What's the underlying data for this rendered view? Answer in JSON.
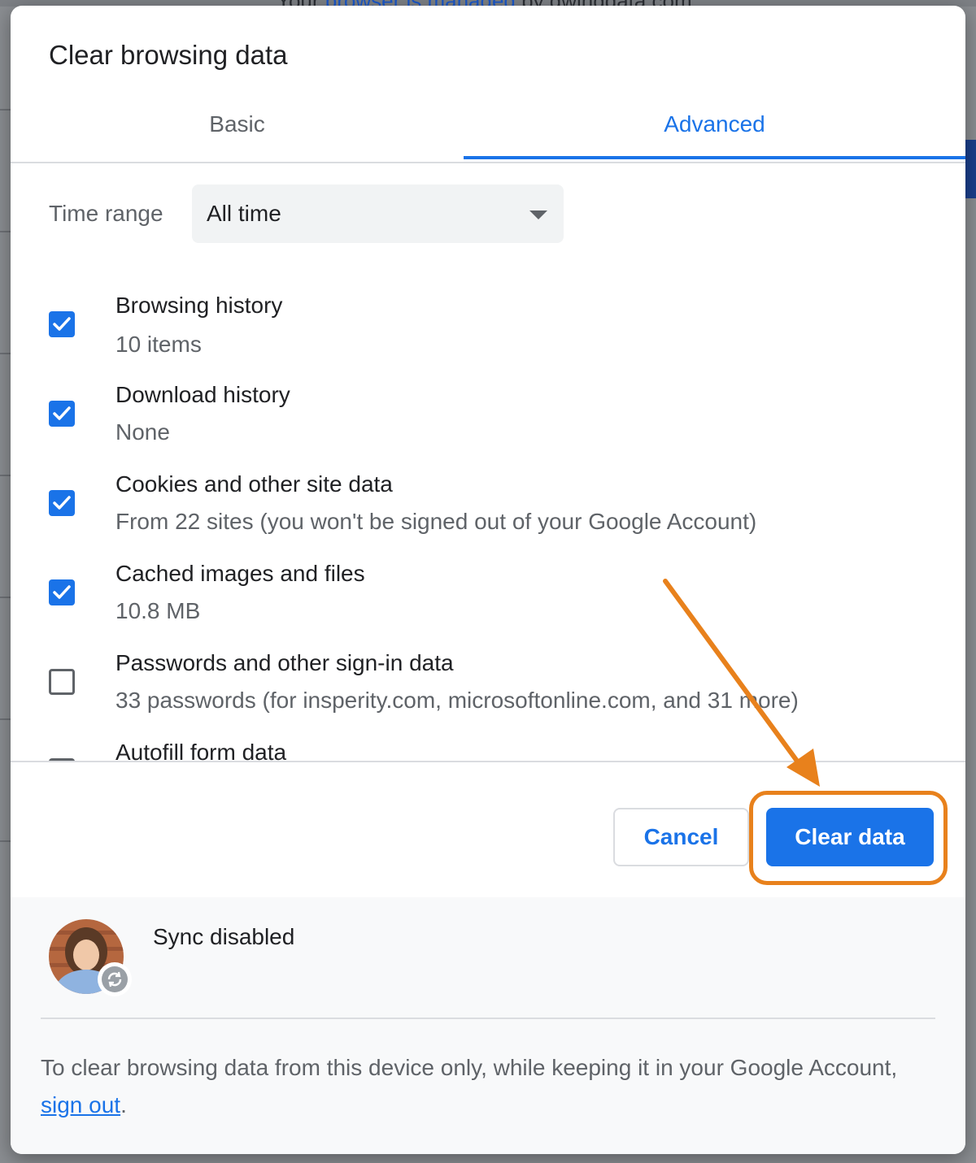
{
  "background": {
    "banner_prefix": "Your ",
    "banner_link": "browser is managed",
    "banner_suffix": " by gwingdata.com"
  },
  "dialog": {
    "title": "Clear browsing data",
    "tabs": [
      {
        "label": "Basic",
        "selected": false
      },
      {
        "label": "Advanced",
        "selected": true
      }
    ],
    "time_range": {
      "label": "Time range",
      "value": "All time"
    },
    "items": [
      {
        "title": "Browsing history",
        "subtitle": "10 items",
        "checked": true
      },
      {
        "title": "Download history",
        "subtitle": "None",
        "checked": true
      },
      {
        "title": "Cookies and other site data",
        "subtitle": "From 22 sites (you won't be signed out of your Google Account)",
        "checked": true
      },
      {
        "title": "Cached images and files",
        "subtitle": "10.8 MB",
        "checked": true
      },
      {
        "title": "Passwords and other sign-in data",
        "subtitle": "33 passwords (for insperity.com, microsoftonline.com, and 31 more)",
        "checked": false
      },
      {
        "title": "Autofill form data",
        "subtitle": "",
        "checked": false
      }
    ],
    "buttons": {
      "cancel": "Cancel",
      "clear": "Clear data"
    },
    "footer": {
      "sync_status": "Sync disabled",
      "note_text": "To clear browsing data from this device only, while keeping it in your Google Account, ",
      "note_link": "sign out",
      "note_end": "."
    }
  },
  "colors": {
    "accent": "#1a73e8",
    "annotation": "#e8811c"
  }
}
